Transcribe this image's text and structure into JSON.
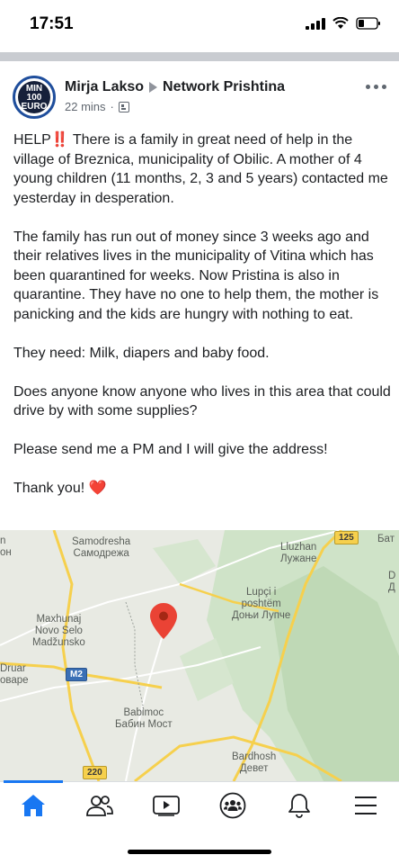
{
  "status_bar": {
    "time": "17:51"
  },
  "post": {
    "author": "Mirja Lakso",
    "group": "Network Prishtina",
    "timestamp": "22 mins",
    "separator": "·",
    "avatar_text_line1": "MIN",
    "avatar_text_line2": "100",
    "avatar_text_line3": "EURO",
    "icons": {
      "share_arrow": "right-triangle-icon",
      "audience": "group-icon",
      "more": "more-options-icon"
    },
    "paragraph1_prefix": "HELP",
    "paragraph1_emoji": "‼️",
    "paragraph1_text": " There is a family in great need of help in the village of Breznica, municipality of Obilic. A mother of 4 young children (11 months, 2, 3 and 5 years) contacted me yesterday in desperation.",
    "paragraph2": "The family has run out of money since 3 weeks ago and their relatives lives in the municipality of Vitina which has been quarantined for weeks. Now Pristina is also in quarantine. They have no one to help them, the mother is panicking and the kids are hungry with nothing to eat.",
    "paragraph3": "They need: Milk, diapers and baby food.",
    "paragraph4": "Does anyone know anyone who lives in this area that could drive by with some supplies?",
    "paragraph5": "Please send me a PM and I will give the address!",
    "paragraph6_text": "Thank you! ",
    "paragraph6_emoji": "❤️"
  },
  "map": {
    "labels": {
      "samodresha": "Samodresha",
      "samodresha_cyr": "Самодрежа",
      "lluzhan": "Lluzhan",
      "lluzhan_cyr": "Лужане",
      "lupci": "Lupçi i",
      "lupci2": "poshtëm",
      "lupci_cyr": "Доњи Лупче",
      "maxhunaj": "Maxhunaj",
      "novo_selo": "Novo Selo",
      "madzunsko": "Madžunsko",
      "babimoc": "Babimoc",
      "babimoc_cyr": "Бабин Мост",
      "bardhosh": "Bardhosh",
      "bardhosh_cyr": "Девет",
      "edge_left_top": "n",
      "edge_left_top2": "он",
      "druar": "Druar",
      "druar_cyr": "оваре",
      "edge_right_top": "Бат",
      "edge_right_d": "D",
      "edge_right_d2": "Д"
    },
    "road_shields": {
      "r125": "125",
      "m2": "M2",
      "r220": "220"
    },
    "pin_icon": "map-pin-icon",
    "colors": {
      "land": "#e8eae3",
      "forest": "#cfe3c8",
      "road_yellow": "#f6d04d",
      "pin": "#ea4335"
    }
  },
  "bottom_nav": {
    "items": [
      "home-icon",
      "friends-icon",
      "watch-icon",
      "groups-icon",
      "notifications-icon",
      "menu-icon"
    ],
    "active": "home-icon",
    "accent": "#1877f2"
  }
}
